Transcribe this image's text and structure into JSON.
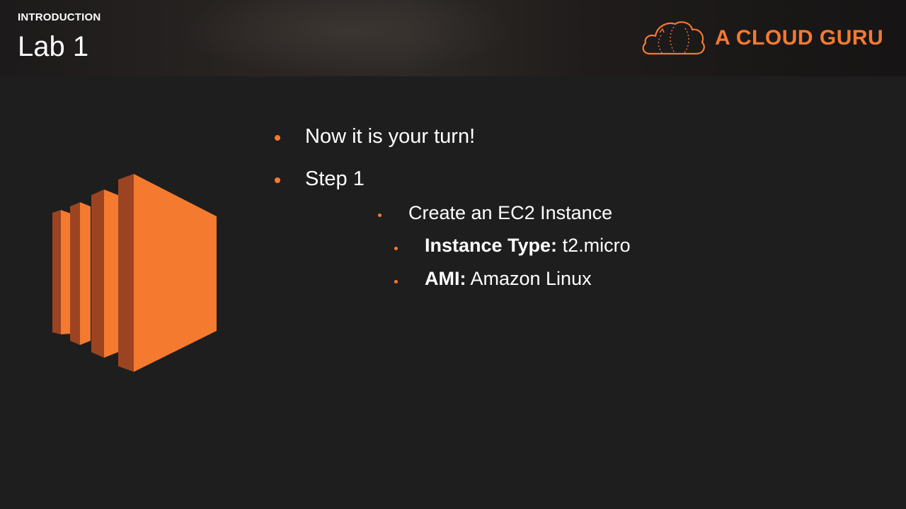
{
  "header": {
    "section_label": "INTRODUCTION",
    "title": "Lab 1",
    "brand_name": "A CLOUD GURU",
    "brand_icon": "cloud-logo-icon"
  },
  "illustration": {
    "icon": "ec2-instance-icon",
    "colors": {
      "face": "#f47a30",
      "side": "#9c4422"
    }
  },
  "bullets": {
    "item1": "Now it is your turn!",
    "item2": "Step 1",
    "sub1": "Create an EC2 Instance",
    "sub1a_label": "Instance Type:",
    "sub1a_value": " t2.micro",
    "sub1b_label": "AMI:",
    "sub1b_value": " Amazon Linux"
  },
  "colors": {
    "accent": "#f47a30",
    "background": "#1e1e1e",
    "text": "#ffffff"
  }
}
